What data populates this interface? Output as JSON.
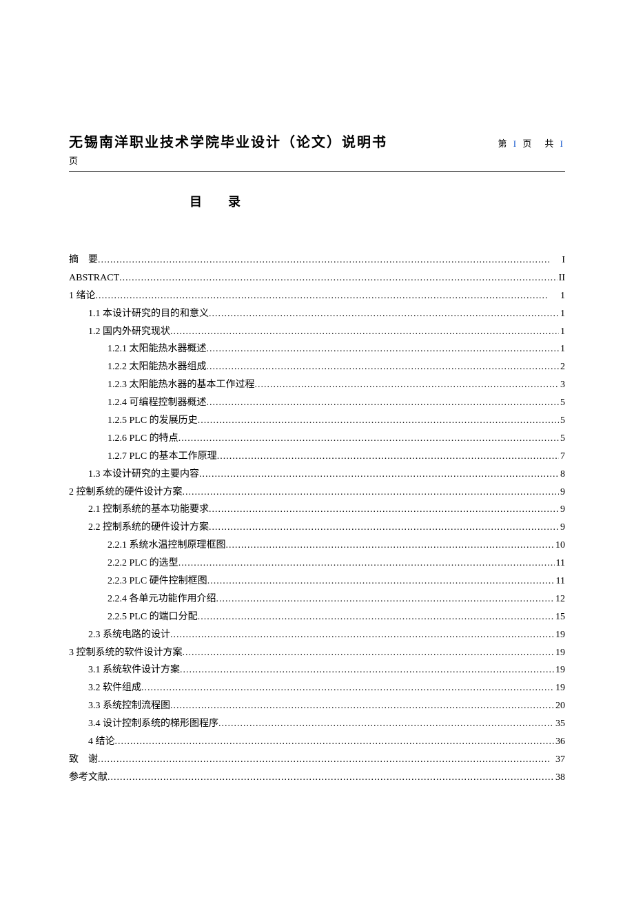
{
  "header": {
    "title": "无锡南洋职业技术学院毕业设计（论文）说明书",
    "page_prefix": "第",
    "page_current": "I",
    "page_mid": "页　共",
    "page_total": "I",
    "page_suffix": "页"
  },
  "toc_title": "目　录",
  "toc": [
    {
      "label": "摘　要",
      "page": "I",
      "indent": 0
    },
    {
      "label": "ABSTRACT",
      "page": "II",
      "indent": 0
    },
    {
      "label": "1 绪论",
      "page": "1",
      "indent": 0
    },
    {
      "label": "1.1 本设计研究的目的和意义",
      "page": "1",
      "indent": 1
    },
    {
      "label": "1.2 国内外研究现状",
      "page": "1",
      "indent": 1
    },
    {
      "label": "1.2.1 太阳能热水器概述",
      "page": "1",
      "indent": 2
    },
    {
      "label": "1.2.2 太阳能热水器组成",
      "page": "2",
      "indent": 2
    },
    {
      "label": "1.2.3 太阳能热水器的基本工作过程",
      "page": "3",
      "indent": 2
    },
    {
      "label": "1.2.4 可编程控制器概述",
      "page": "5",
      "indent": 2
    },
    {
      "label": "1.2.5 PLC 的发展历史",
      "page": "5",
      "indent": 2
    },
    {
      "label": "1.2.6 PLC 的特点",
      "page": "5",
      "indent": 2
    },
    {
      "label": "1.2.7 PLC 的基本工作原理",
      "page": "7",
      "indent": 2
    },
    {
      "label": "1.3 本设计研究的主要内容",
      "page": "8",
      "indent": 1
    },
    {
      "label": "2 控制系统的硬件设计方案",
      "page": "9",
      "indent": 0
    },
    {
      "label": "2.1 控制系统的基本功能要求",
      "page": "9",
      "indent": 1
    },
    {
      "label": "2.2 控制系统的硬件设计方案",
      "page": "9",
      "indent": 1
    },
    {
      "label": "2.2.1 系统水温控制原理框图",
      "page": "10",
      "indent": 2
    },
    {
      "label": "2.2.2 PLC 的选型",
      "page": "11",
      "indent": 2
    },
    {
      "label": "2.2.3 PLC 硬件控制框图",
      "page": "11",
      "indent": 2
    },
    {
      "label": "2.2.4 各单元功能作用介绍",
      "page": "12",
      "indent": 2
    },
    {
      "label": "2.2.5 PLC 的端口分配",
      "page": "15",
      "indent": 2
    },
    {
      "label": "2.3 系统电路的设计",
      "page": "19",
      "indent": 1
    },
    {
      "label": "3 控制系统的软件设计方案",
      "page": "19",
      "indent": 0
    },
    {
      "label": "3.1 系统软件设计方案",
      "page": "19",
      "indent": 1
    },
    {
      "label": "3.2 软件组成",
      "page": "19",
      "indent": 1
    },
    {
      "label": "3.3 系统控制流程图",
      "page": "20",
      "indent": 1
    },
    {
      "label": "3.4 设计控制系统的梯形图程序",
      "page": "35",
      "indent": 1
    },
    {
      "label": "4 结论",
      "page": "36",
      "indent": 1
    },
    {
      "label": "致　谢",
      "page": "37",
      "indent": 0
    },
    {
      "label": "参考文献",
      "page": "38",
      "indent": 0
    }
  ]
}
